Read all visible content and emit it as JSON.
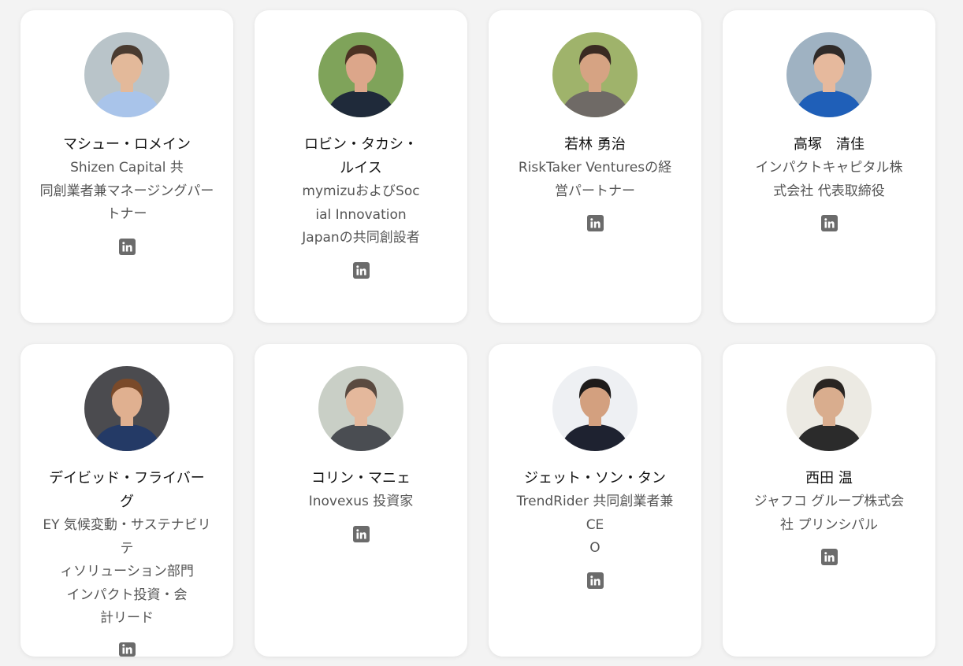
{
  "members": [
    {
      "name": "マシュー・ロメイン",
      "role": "Shizen Capital 共同創業者兼マネージングパートナー",
      "icon": "linkedin-icon",
      "photo": {
        "bg": "#b9c4c9",
        "skin": "#e3b99a",
        "hair": "#4a3b30",
        "shirt": "#a9c4ea"
      }
    },
    {
      "name": "ロビン・タカシ・ルイス",
      "role": "mymizuおよびSocial Innovation Japanの共同創設者",
      "icon": "linkedin-icon",
      "photo": {
        "bg": "#7fa35a",
        "skin": "#dca68a",
        "hair": "#4b3223",
        "shirt": "#1f2a3a"
      }
    },
    {
      "name": "若林 勇治",
      "role": "RiskTaker Venturesの経営パートナー",
      "icon": "linkedin-icon",
      "photo": {
        "bg": "#9fb36b",
        "skin": "#d6a383",
        "hair": "#3a2a22",
        "shirt": "#6f6a66"
      }
    },
    {
      "name": "高塚　清佳",
      "role": "インパクトキャピタル株式会社 代表取締役",
      "icon": "linkedin-icon",
      "photo": {
        "bg": "#9fb2c2",
        "skin": "#e6b99d",
        "hair": "#2f2a28",
        "shirt": "#1f5fb8"
      }
    },
    {
      "name": "デイビッド・フライバーグ",
      "role": "EY 気候変動・サステナビリティソリューション部門 インパクト投資・会計リード",
      "icon": "linkedin-icon",
      "photo": {
        "bg": "#4b4b4f",
        "skin": "#e0b090",
        "hair": "#7a4a2a",
        "shirt": "#243a66"
      }
    },
    {
      "name": "コリン・マニェ",
      "role": "Inovexus 投資家",
      "icon": "linkedin-icon",
      "photo": {
        "bg": "#c9cfc6",
        "skin": "#e4b89c",
        "hair": "#5a4a40",
        "shirt": "#4a4d52"
      }
    },
    {
      "name": "ジェット・ソン・タン",
      "role": "TrendRider 共同創業者兼 CEO",
      "icon": "linkedin-icon",
      "photo": {
        "bg": "#eef0f3",
        "skin": "#d3a07f",
        "hair": "#1e1b1a",
        "shirt": "#1e2230"
      }
    },
    {
      "name": "西田 温",
      "role": "ジャフコ グループ株式会社 プリンシパル",
      "icon": "linkedin-icon",
      "photo": {
        "bg": "#eceae3",
        "skin": "#d9ad8e",
        "hair": "#2a2522",
        "shirt": "#2b2b2b"
      }
    }
  ]
}
